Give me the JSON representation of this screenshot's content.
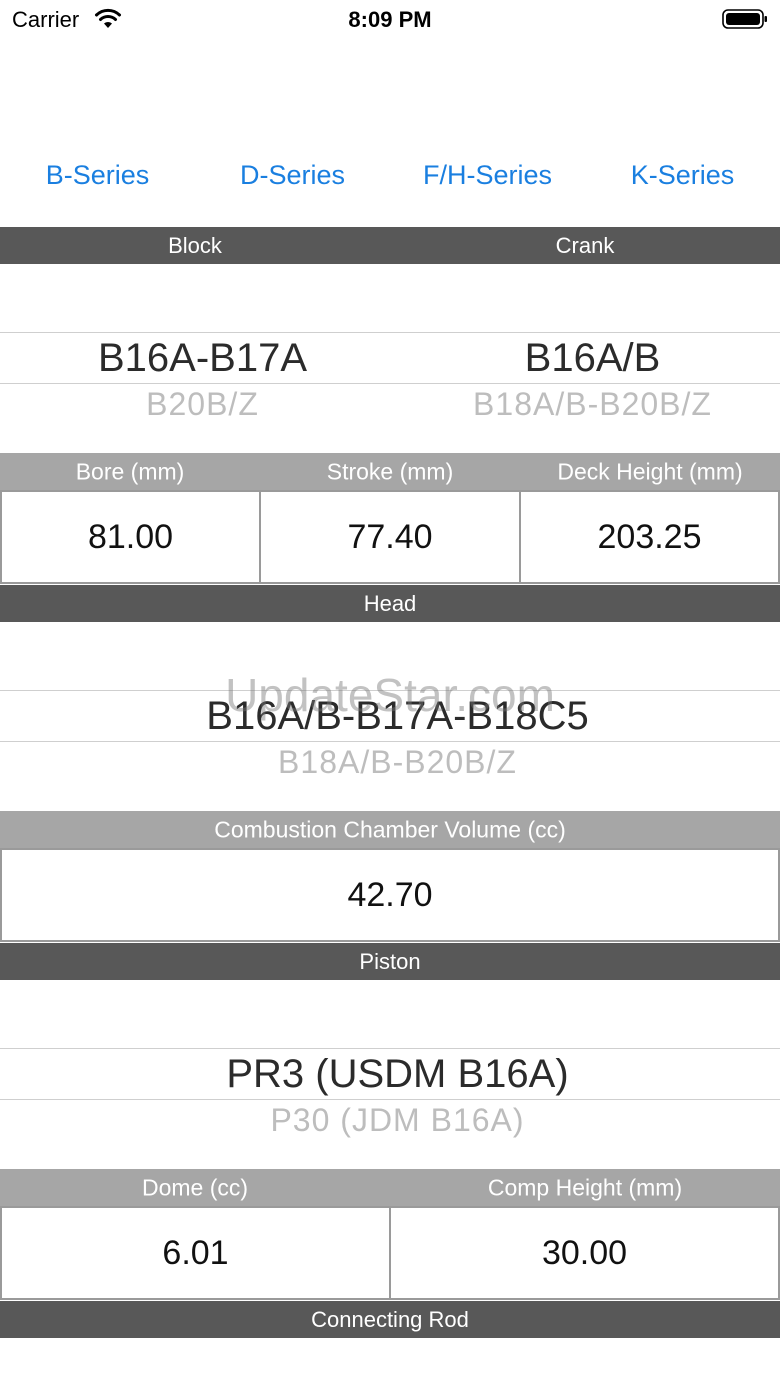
{
  "status": {
    "carrier": "Carrier",
    "time": "8:09 PM"
  },
  "nav": {
    "tabs": [
      {
        "label": "B-Series"
      },
      {
        "label": "D-Series"
      },
      {
        "label": "F/H-Series"
      },
      {
        "label": "K-Series"
      }
    ]
  },
  "block_crank": {
    "headers": {
      "block": "Block",
      "crank": "Crank"
    },
    "block_picker": {
      "selected": "B16A-B17A",
      "next": "B20B/Z"
    },
    "crank_picker": {
      "selected": "B16A/B",
      "next": "B18A/B-B20B/Z"
    },
    "fields": {
      "bore_label": "Bore (mm)",
      "stroke_label": "Stroke (mm)",
      "deck_label": "Deck Height (mm)",
      "bore": "81.00",
      "stroke": "77.40",
      "deck": "203.25"
    }
  },
  "head": {
    "header": "Head",
    "picker": {
      "selected": "B16A/B-B17A-B18C5",
      "next": "B18A/B-B20B/Z"
    },
    "chamber_label": "Combustion Chamber Volume (cc)",
    "chamber": "42.70"
  },
  "piston": {
    "header": "Piston",
    "picker": {
      "selected": "PR3 (USDM B16A)",
      "next": "P30 (JDM B16A)"
    },
    "dome_label": "Dome (cc)",
    "comp_label": "Comp Height (mm)",
    "dome": "6.01",
    "comp": "30.00"
  },
  "rod": {
    "header": "Connecting Rod"
  },
  "watermark": "UpdateStar.com"
}
